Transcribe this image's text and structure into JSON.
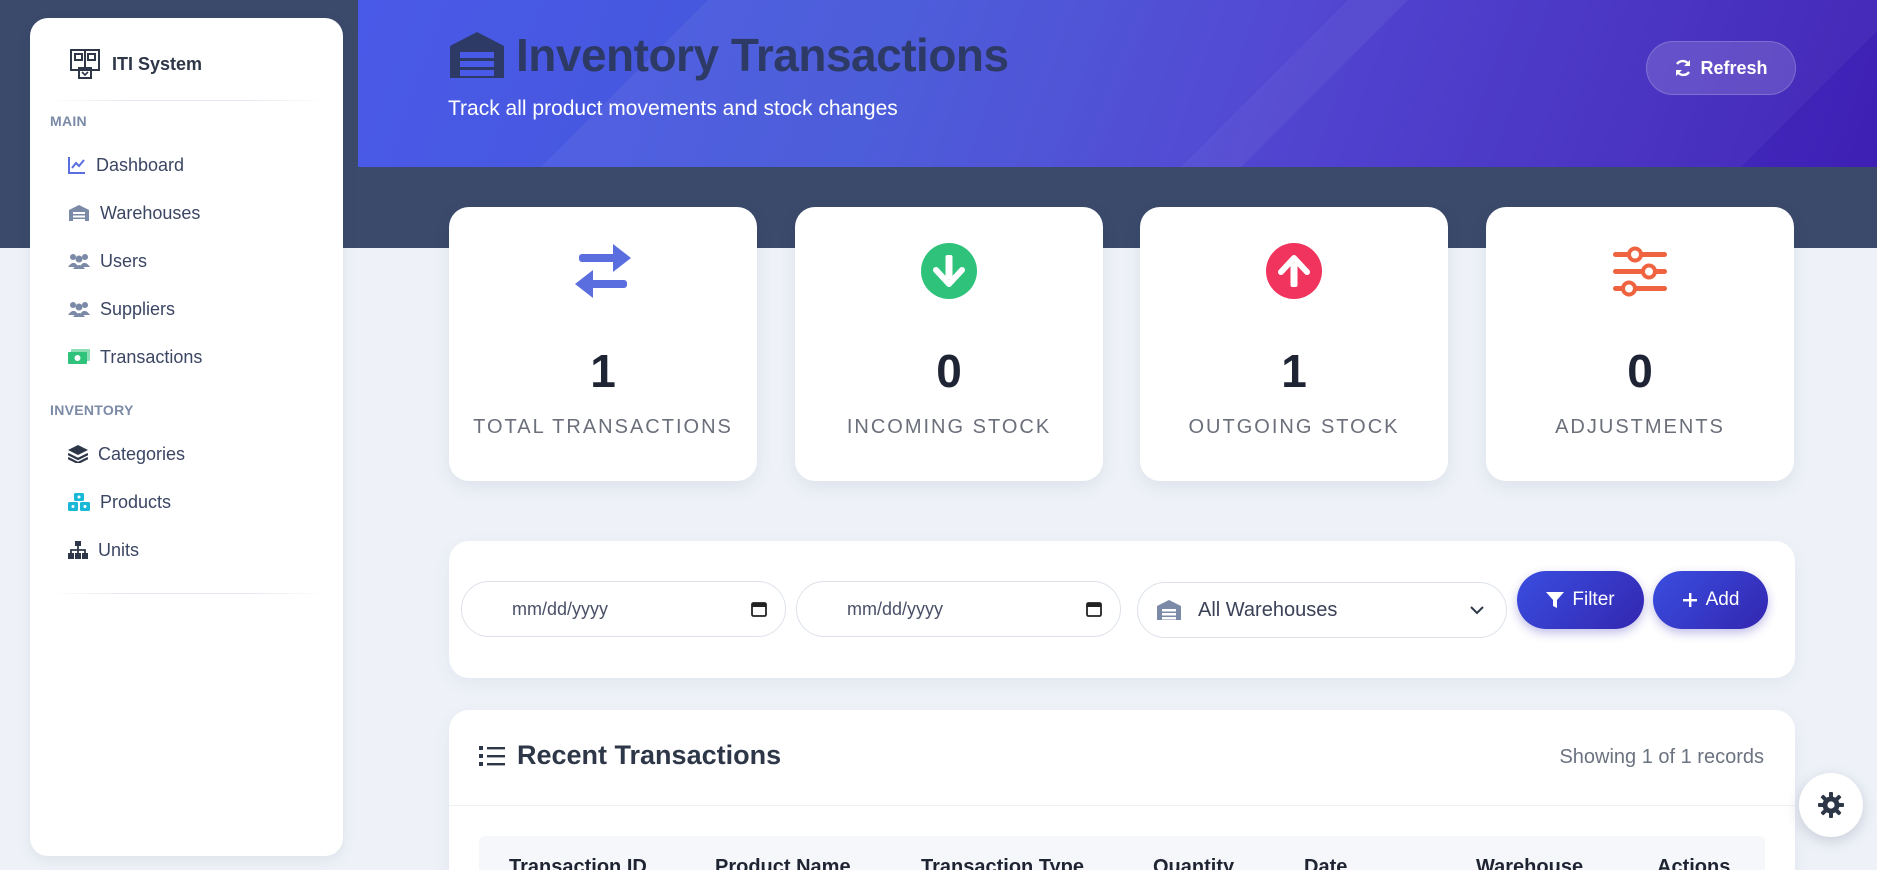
{
  "app": {
    "brand": "ITI System"
  },
  "sidebar": {
    "sections": [
      {
        "label": "MAIN"
      },
      {
        "label": "INVENTORY"
      }
    ],
    "items": [
      {
        "label": "Dashboard",
        "icon": "chart-line-icon"
      },
      {
        "label": "Warehouses",
        "icon": "warehouse-icon"
      },
      {
        "label": "Users",
        "icon": "users-icon"
      },
      {
        "label": "Suppliers",
        "icon": "users-icon"
      },
      {
        "label": "Transactions",
        "icon": "money-bill-icon"
      },
      {
        "label": "Categories",
        "icon": "layers-icon"
      },
      {
        "label": "Products",
        "icon": "cubes-icon"
      },
      {
        "label": "Units",
        "icon": "sitemap-icon"
      }
    ]
  },
  "header": {
    "title": "Inventory Transactions",
    "subtitle": "Track all product movements and stock changes",
    "refresh_label": "Refresh"
  },
  "stats": [
    {
      "value": "1",
      "label": "TOTAL TRANSACTIONS",
      "icon": "exchange-icon",
      "color": "#5a6ee0"
    },
    {
      "value": "0",
      "label": "INCOMING STOCK",
      "icon": "arrow-down-circle-icon",
      "color": "#2fc27b"
    },
    {
      "value": "1",
      "label": "OUTGOING STOCK",
      "icon": "arrow-up-circle-icon",
      "color": "#f0345e"
    },
    {
      "value": "0",
      "label": "ADJUSTMENTS",
      "icon": "sliders-icon",
      "color": "#f06340"
    }
  ],
  "filters": {
    "start_date_placeholder": "mm/dd/yyyy",
    "end_date_placeholder": "mm/dd/yyyy",
    "warehouse_selected": "All Warehouses",
    "filter_label": "Filter",
    "add_label": "Add"
  },
  "transactions": {
    "title": "Recent Transactions",
    "count_text": "Showing 1 of 1 records",
    "columns": [
      "Transaction ID",
      "Product Name",
      "Transaction Type",
      "Quantity",
      "Date",
      "Warehouse",
      "Actions"
    ]
  },
  "colors": {
    "accent": "#3a4ee0",
    "header_start": "#4a5ae8",
    "header_end": "#3e1fb4",
    "band": "#3b4a6b"
  }
}
